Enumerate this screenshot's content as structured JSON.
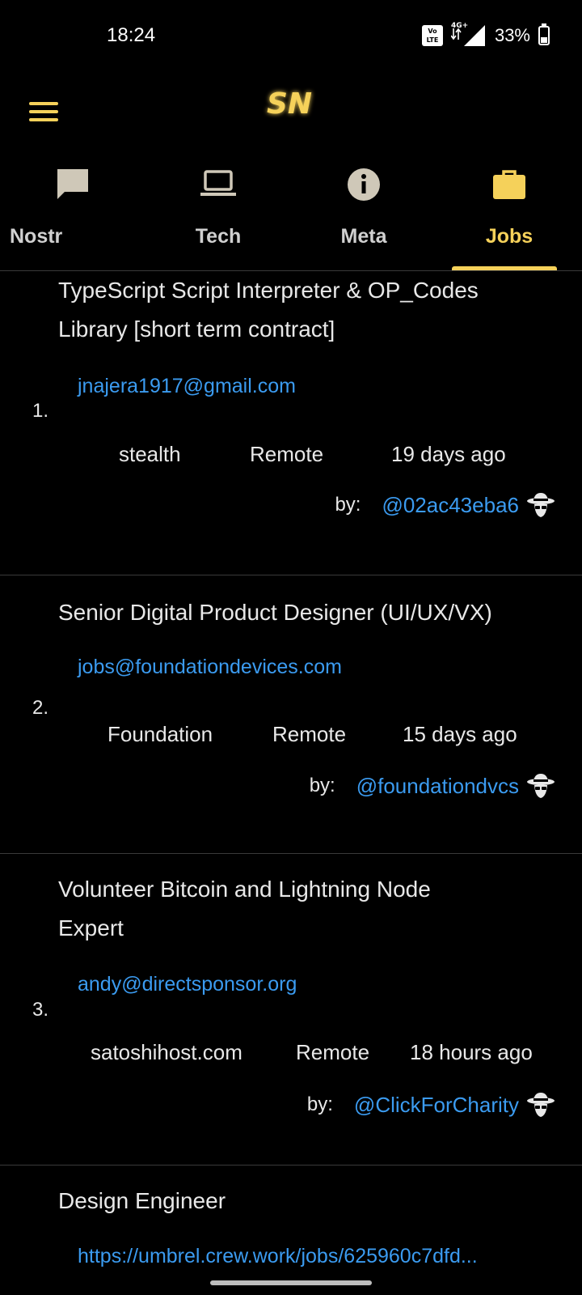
{
  "status_bar": {
    "time": "18:24",
    "volte_top": "Vo",
    "volte_bottom": "LTE",
    "network": "4G+",
    "battery_percent": "33%",
    "battery_level": 0.33
  },
  "app": {
    "logo_text": "SN",
    "accent_color": "#f5d15a",
    "link_color": "#3b9bf0"
  },
  "tabs": [
    {
      "label": "Nostr",
      "icon": "chat-bubble-icon",
      "active": false
    },
    {
      "label": "Tech",
      "icon": "laptop-icon",
      "active": false
    },
    {
      "label": "Meta",
      "icon": "info-icon",
      "active": false
    },
    {
      "label": "Jobs",
      "icon": "briefcase-icon",
      "active": true
    }
  ],
  "jobs": [
    {
      "rank": "1.",
      "title_line1": "TypeScript Script Interpreter & OP_Codes",
      "title_line2": "Library [short term contract]",
      "contact": "jnajera1917@gmail.com",
      "company": "stealth",
      "location": "Remote",
      "age": "19 days ago",
      "by_label": "by:",
      "user": "@02ac43eba6"
    },
    {
      "rank": "2.",
      "title_line1": "Senior Digital Product Designer (UI/UX/VX)",
      "contact": "jobs@foundationdevices.com",
      "company": "Foundation",
      "location": "Remote",
      "age": "15 days ago",
      "by_label": "by:",
      "user": "@foundationdvcs"
    },
    {
      "rank": "3.",
      "title_line1": "Volunteer Bitcoin and Lightning Node",
      "title_line2": "Expert",
      "contact": "andy@directsponsor.org",
      "company": "satoshihost.com",
      "location": "Remote",
      "age": "18 hours ago",
      "by_label": "by:",
      "user": "@ClickForCharity"
    },
    {
      "title_line1": "Design Engineer",
      "contact": "https://umbrel.crew.work/jobs/625960c7dfd..."
    }
  ]
}
